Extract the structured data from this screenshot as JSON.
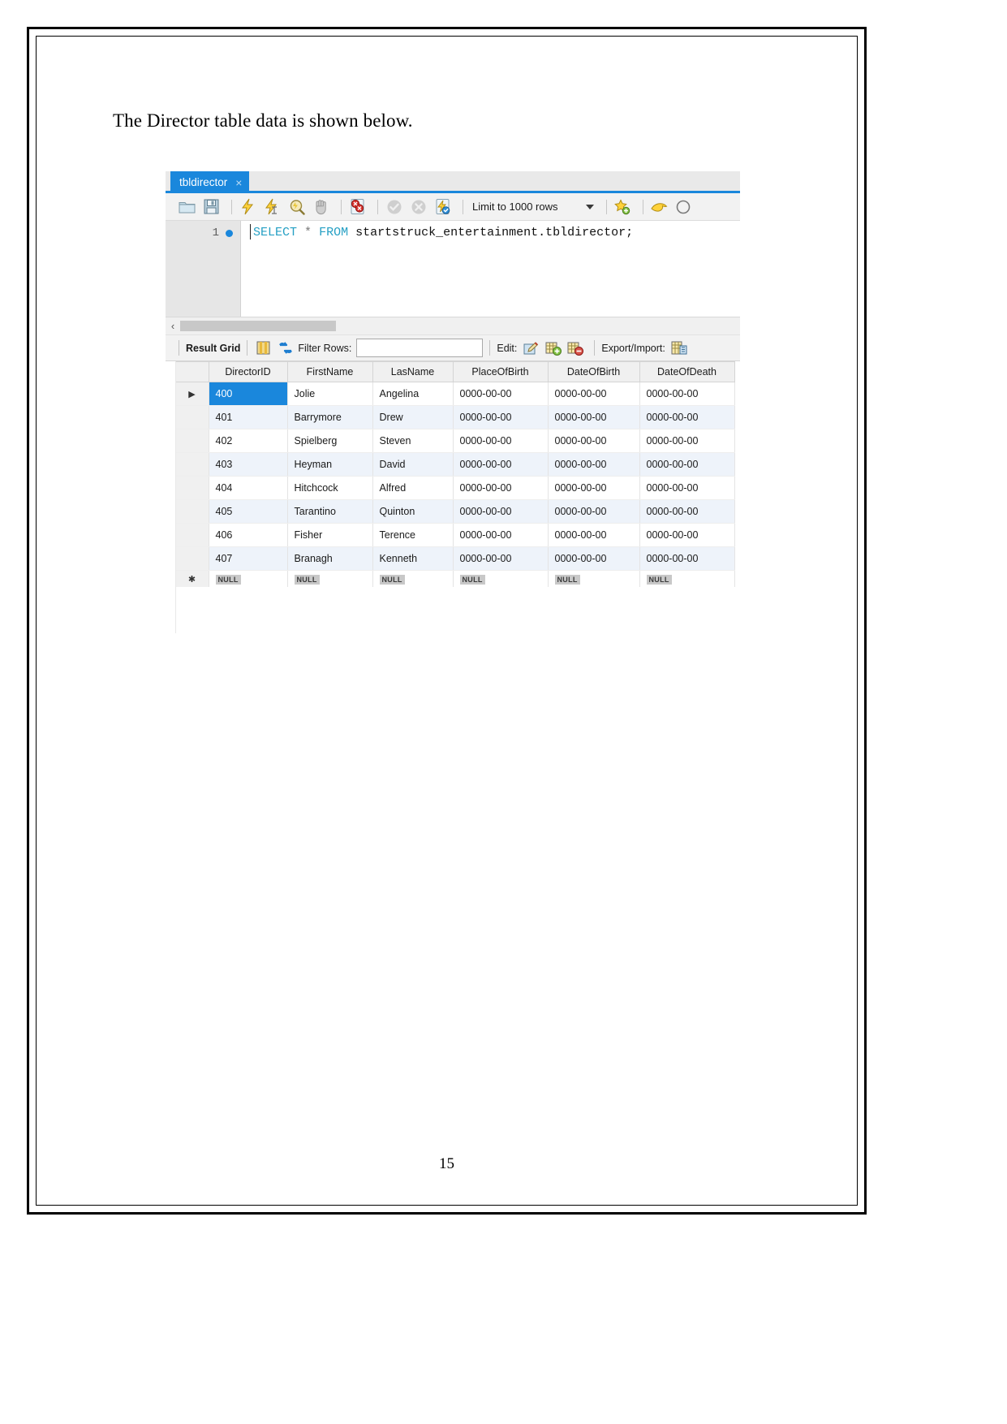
{
  "document": {
    "intro_text": "The Director table data is shown below.",
    "page_number": "15"
  },
  "workbench": {
    "tab": {
      "label": "tbldirector",
      "close_glyph": "×"
    },
    "toolbar": {
      "icons": [
        "open-folder-icon",
        "save-icon",
        "execute-lightning-icon",
        "execute-current-lightning-icon",
        "explain-magnifier-icon",
        "stop-hand-icon",
        "toggle-stop-on-error-icon",
        "commit-check-icon",
        "rollback-x-icon",
        "autocommit-icon"
      ],
      "limit_label": "Limit to 1000 rows",
      "dropdown_glyph": "▾"
    },
    "editor": {
      "line_number": "1",
      "sql": {
        "select": "SELECT",
        "star": "*",
        "from": "FROM",
        "target": "startstruck_entertainment.tbldirector;"
      }
    },
    "scrollbar": {
      "left_arrow": "‹"
    },
    "gridbar": {
      "result_grid_label": "Result Grid",
      "grid_view_icon": "grid-view-icon",
      "refresh_icon": "refresh-icon",
      "filter_label": "Filter Rows:",
      "filter_value": "",
      "filter_placeholder": "",
      "edit_label": "Edit:",
      "edit_icons": [
        "edit-pencil-icon",
        "insert-row-icon",
        "delete-row-icon"
      ],
      "export_label": "Export/Import:",
      "export_icon": "export-icon"
    },
    "grid": {
      "columns": [
        "DirectorID",
        "FirstName",
        "LasName",
        "PlaceOfBirth",
        "DateOfBirth",
        "DateOfDeath"
      ],
      "rows": [
        {
          "marker": "▶",
          "selected": true,
          "cells": [
            "400",
            "Jolie",
            "Angelina",
            "0000-00-00",
            "0000-00-00",
            "0000-00-00"
          ]
        },
        {
          "marker": "",
          "selected": false,
          "cells": [
            "401",
            "Barrymore",
            "Drew",
            "0000-00-00",
            "0000-00-00",
            "0000-00-00"
          ]
        },
        {
          "marker": "",
          "selected": false,
          "cells": [
            "402",
            "Spielberg",
            "Steven",
            "0000-00-00",
            "0000-00-00",
            "0000-00-00"
          ]
        },
        {
          "marker": "",
          "selected": false,
          "cells": [
            "403",
            "Heyman",
            "David",
            "0000-00-00",
            "0000-00-00",
            "0000-00-00"
          ]
        },
        {
          "marker": "",
          "selected": false,
          "cells": [
            "404",
            "Hitchcock",
            "Alfred",
            "0000-00-00",
            "0000-00-00",
            "0000-00-00"
          ]
        },
        {
          "marker": "",
          "selected": false,
          "cells": [
            "405",
            "Tarantino",
            "Quinton",
            "0000-00-00",
            "0000-00-00",
            "0000-00-00"
          ]
        },
        {
          "marker": "",
          "selected": false,
          "cells": [
            "406",
            "Fisher",
            "Terence",
            "0000-00-00",
            "0000-00-00",
            "0000-00-00"
          ]
        },
        {
          "marker": "",
          "selected": false,
          "cells": [
            "407",
            "Branagh",
            "Kenneth",
            "0000-00-00",
            "0000-00-00",
            "0000-00-00"
          ]
        }
      ],
      "null_row": {
        "marker": "✱",
        "label": "NULL",
        "count": 6
      }
    }
  },
  "colors": {
    "accent_blue": "#1a87dc",
    "row_alt": "#eef3fa",
    "toolbar_bg": "#f2f2f2",
    "sql_keyword": "#26a0c4"
  }
}
